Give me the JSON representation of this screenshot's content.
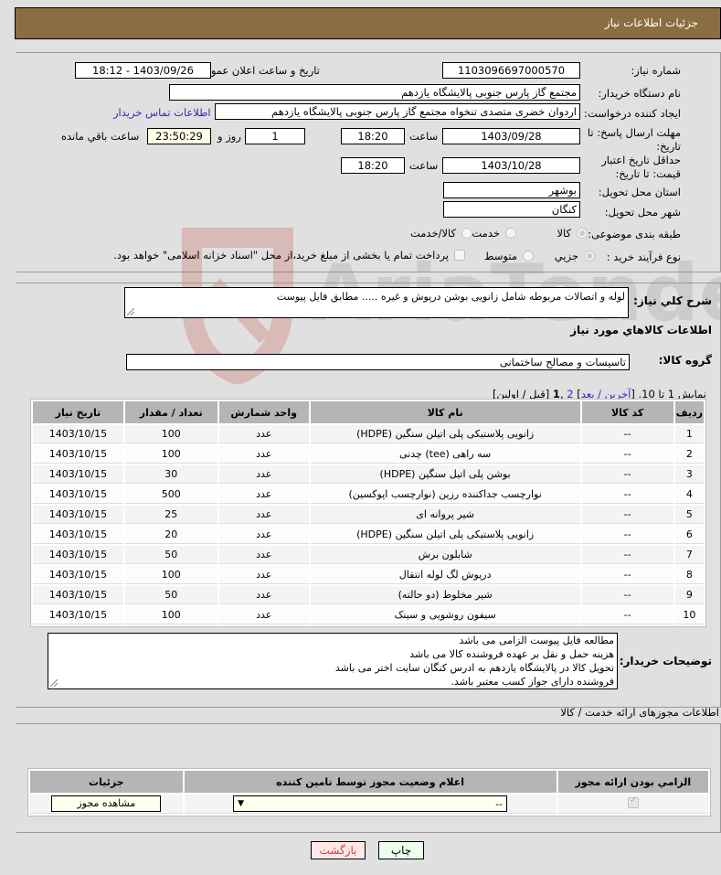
{
  "header": {
    "title": "جزئيات اطلاعات نياز"
  },
  "form": {
    "need_number": {
      "label": "شماره نياز:",
      "value": "1103096697000570"
    },
    "announce": {
      "label": "تاريخ و ساعت اعلان عمومي:",
      "value": "1403/09/26 - 18:12"
    },
    "buyer_org": {
      "label": "نام دستگاه خريدار:",
      "value": "مجتمع گاز پارس جنوبی  پالایشگاه یازدهم"
    },
    "creator": {
      "label": "ايجاد کننده درخواست:",
      "value": "اردوان خضری متصدی تنخواه مجتمع گاز پارس جنوبی  پالایشگاه یازدهم",
      "contact_link": "اطلاعات تماس خريدار"
    },
    "response_deadline": {
      "label": "مهلت ارسال پاسخ: تا تاريخ:",
      "date": "1403/09/28",
      "time_label": "ساعت",
      "time": "18:20",
      "days": "1",
      "days_label": "روز و",
      "remaining": "23:50:29",
      "remaining_label": "ساعت باقي مانده"
    },
    "price_validity": {
      "label": "حداقل تاريخ اعتبار قيمت: تا تاريخ:",
      "date": "1403/10/28",
      "time_label": "ساعت",
      "time": "18:20"
    },
    "province": {
      "label": "استان محل تحويل:",
      "value": "بوشهر"
    },
    "city": {
      "label": "شهر محل تحويل:",
      "value": "کنگان"
    },
    "category": {
      "label": "طبقه بندی موضوعی:",
      "options": [
        "کالا",
        "خدمت",
        "کالا/خدمت"
      ],
      "selected": "کالا"
    },
    "purchase_type": {
      "label": "نوع فرآيند خريد :",
      "options": [
        "جزيي",
        "متوسط"
      ],
      "selected": "جزيي",
      "treasury_note": "پرداخت تمام یا بخشی از مبلغ خرید،از محل \"اسناد خزانه اسلامی\" خواهد بود."
    }
  },
  "description": {
    "label": "شرح کلي نياز:",
    "value": "لوله و اتصالات مربوطه شامل زانویی بوشن درپوش و غیره ..... مطابق فایل پیوست"
  },
  "goods_section": {
    "title": "اطلاعات کالاهاي مورد نياز",
    "group_label": "گروه کالا:",
    "group_value": "تاسیسات و مصالح ساختمانی",
    "pagination": {
      "prefix": "نمايش 1 تا 10. [",
      "last": "آخرين",
      "sep1": " / ",
      "next": "بعد",
      "mid": "] ",
      "page2": "2",
      "comma": " ,",
      "page1": "1",
      "suffix": " [قبل / اولين]"
    },
    "columns": [
      "رديف",
      "کد کالا",
      "نام کالا",
      "واحد شمارش",
      "تعداد / مقدار",
      "تاريخ نياز"
    ],
    "rows": [
      [
        "1",
        "--",
        "زانویی پلاستیکی پلی اتیلن سنگین (HDPE)",
        "عدد",
        "100",
        "1403/10/15"
      ],
      [
        "2",
        "--",
        "سه راهی (tee) چدنی",
        "عدد",
        "100",
        "1403/10/15"
      ],
      [
        "3",
        "--",
        "بوشن پلی اتیل سنگین (HDPE)",
        "عدد",
        "30",
        "1403/10/15"
      ],
      [
        "4",
        "--",
        "نوارچسب جداکننده رزین (نوارچسب اپوکسین)",
        "عدد",
        "500",
        "1403/10/15"
      ],
      [
        "5",
        "--",
        "شیر پروانه ای",
        "عدد",
        "25",
        "1403/10/15"
      ],
      [
        "6",
        "--",
        "زانویی پلاستیکی پلی اتیلن سنگین (HDPE)",
        "عدد",
        "20",
        "1403/10/15"
      ],
      [
        "7",
        "--",
        "شابلون برش",
        "عدد",
        "50",
        "1403/10/15"
      ],
      [
        "8",
        "--",
        "درپوش لگ لوله انتقال",
        "عدد",
        "100",
        "1403/10/15"
      ],
      [
        "9",
        "--",
        "شیر مخلوط (دو حالته)",
        "عدد",
        "50",
        "1403/10/15"
      ],
      [
        "10",
        "--",
        "سیفون روشویی و سینک",
        "عدد",
        "100",
        "1403/10/15"
      ]
    ]
  },
  "buyer_notes": {
    "label": "توضيحات خريدار:",
    "lines": [
      "مطالعه فایل پیوست الزامی می باشد",
      "هزینه حمل و نقل بر عهده فروشنده کالا می باشد",
      "تحویل کالا در پالایشگاه یازدهم به ادرس کنگان سایت اختر می باشد",
      "فروشنده دارای جواز کسب معتبر باشد."
    ]
  },
  "permits": {
    "title": "اطلاعات مجوزهای ارائه خدمت / کالا",
    "columns": [
      "الزامي بودن ارائه مجوز",
      "اعلام وضعيت مجوز توسط تامين کننده",
      "جزئيات"
    ],
    "row": {
      "required_checked": true,
      "status_value": "--",
      "view_button": "مشاهده مجوز"
    }
  },
  "actions": {
    "print": "چاپ",
    "back": "بازگشت"
  },
  "watermark": {
    "text": "AriaTender.neT"
  },
  "colors": {
    "header_bg": "#8b6d42",
    "link": "#2a2ad0",
    "back_btn_bg": "#ffe8e8",
    "print_btn_bg": "#ecffec"
  }
}
